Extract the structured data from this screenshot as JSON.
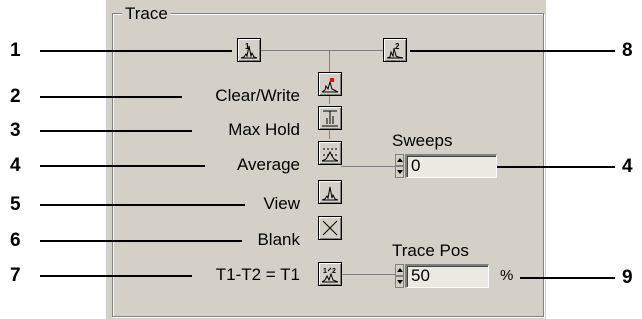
{
  "group": {
    "title": "Trace"
  },
  "callouts": [
    "1",
    "2",
    "3",
    "4",
    "5",
    "6",
    "7",
    "8",
    "4",
    "9"
  ],
  "modes": {
    "clear_write": "Clear/Write",
    "max_hold": "Max Hold",
    "average": "Average",
    "view": "View",
    "blank": "Blank",
    "t1_t2": "T1-T2 = T1"
  },
  "sweeps": {
    "label": "Sweeps",
    "value": "0"
  },
  "trace_pos": {
    "label": "Trace Pos",
    "value": "50",
    "unit": "%"
  },
  "icons": {
    "trace1": "trace-1-select-icon",
    "trace2": "trace-2-select-icon",
    "clear_write": "clear-write-icon",
    "max_hold": "max-hold-icon",
    "average": "average-icon",
    "view": "view-icon",
    "blank": "blank-x-icon",
    "t1_t2": "trace-difference-icon"
  },
  "colors": {
    "panel": "#d4d0c8",
    "marker_red": "#ff0000"
  }
}
